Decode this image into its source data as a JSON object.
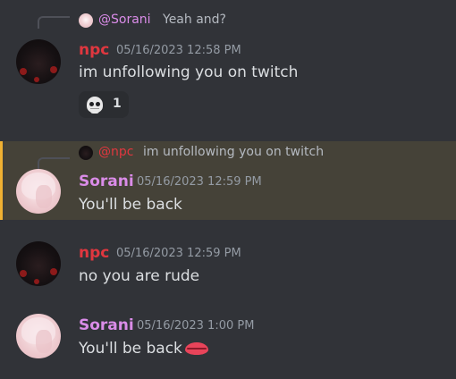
{
  "messages": [
    {
      "reply": {
        "mention": "@Sorani",
        "text": "Yeah and?"
      },
      "author": "npc",
      "timestamp": "05/16/2023 12:58 PM",
      "text": "im unfollowing you on twitch",
      "reaction": {
        "emoji": "skull",
        "count": "1"
      }
    },
    {
      "reply": {
        "mention": "@npc",
        "text": "im unfollowing you on twitch"
      },
      "author": "Sorani",
      "timestamp": "05/16/2023 12:59 PM",
      "text": "You'll be back",
      "highlighted": true
    },
    {
      "author": "npc",
      "timestamp": "05/16/2023 12:59 PM",
      "text": "no you are rude"
    },
    {
      "author": "Sorani",
      "timestamp": "05/16/2023 1:00 PM",
      "text": "You'll be back",
      "trailing_emoji": "lips"
    }
  ],
  "colors": {
    "background": "#313338",
    "highlight": "#454238",
    "highlight_bar": "#f0b132",
    "npc_name": "#e0373f",
    "sorani_name": "#da8ce8",
    "timestamp": "#949ba4"
  }
}
